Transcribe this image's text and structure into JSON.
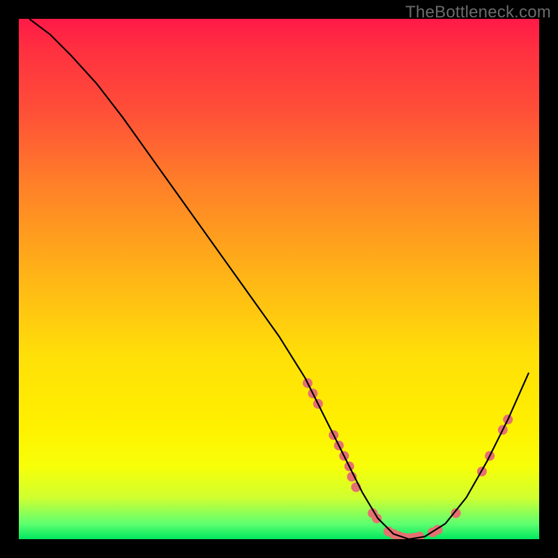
{
  "watermark": "TheBottleneck.com",
  "chart_data": {
    "type": "line",
    "title": "",
    "xlabel": "",
    "ylabel": "",
    "xlim": [
      0,
      100
    ],
    "ylim": [
      0,
      100
    ],
    "series": [
      {
        "name": "bottleneck-curve",
        "color": "#000000",
        "x": [
          2,
          6,
          10,
          15,
          20,
          25,
          30,
          35,
          40,
          45,
          50,
          55,
          58,
          60,
          63,
          66,
          69,
          72,
          75,
          78,
          82,
          86,
          90,
          94,
          98
        ],
        "y": [
          100,
          97,
          93,
          87.5,
          81,
          74,
          67,
          60,
          53,
          46,
          39,
          31,
          25,
          21,
          15,
          9,
          4,
          1,
          0,
          0.5,
          3,
          8,
          15,
          23,
          32
        ]
      }
    ],
    "markers": [
      {
        "x": 55.5,
        "y": 30
      },
      {
        "x": 56.5,
        "y": 28
      },
      {
        "x": 57.5,
        "y": 26
      },
      {
        "x": 60.5,
        "y": 20
      },
      {
        "x": 61.5,
        "y": 18
      },
      {
        "x": 62.5,
        "y": 16
      },
      {
        "x": 63.5,
        "y": 14
      },
      {
        "x": 64.0,
        "y": 12
      },
      {
        "x": 64.8,
        "y": 10
      },
      {
        "x": 68.0,
        "y": 5
      },
      {
        "x": 68.8,
        "y": 4
      },
      {
        "x": 71.0,
        "y": 1.5
      },
      {
        "x": 72.0,
        "y": 1
      },
      {
        "x": 73.0,
        "y": 0.6
      },
      {
        "x": 74.0,
        "y": 0.3
      },
      {
        "x": 75.0,
        "y": 0.2
      },
      {
        "x": 76.0,
        "y": 0.3
      },
      {
        "x": 77.0,
        "y": 0.5
      },
      {
        "x": 79.5,
        "y": 1.3
      },
      {
        "x": 80.5,
        "y": 1.8
      },
      {
        "x": 84.0,
        "y": 5
      },
      {
        "x": 89.0,
        "y": 13
      },
      {
        "x": 90.5,
        "y": 16
      },
      {
        "x": 93.0,
        "y": 21
      },
      {
        "x": 94.0,
        "y": 23
      }
    ],
    "marker_color": "#e67070",
    "marker_radius": 7
  }
}
